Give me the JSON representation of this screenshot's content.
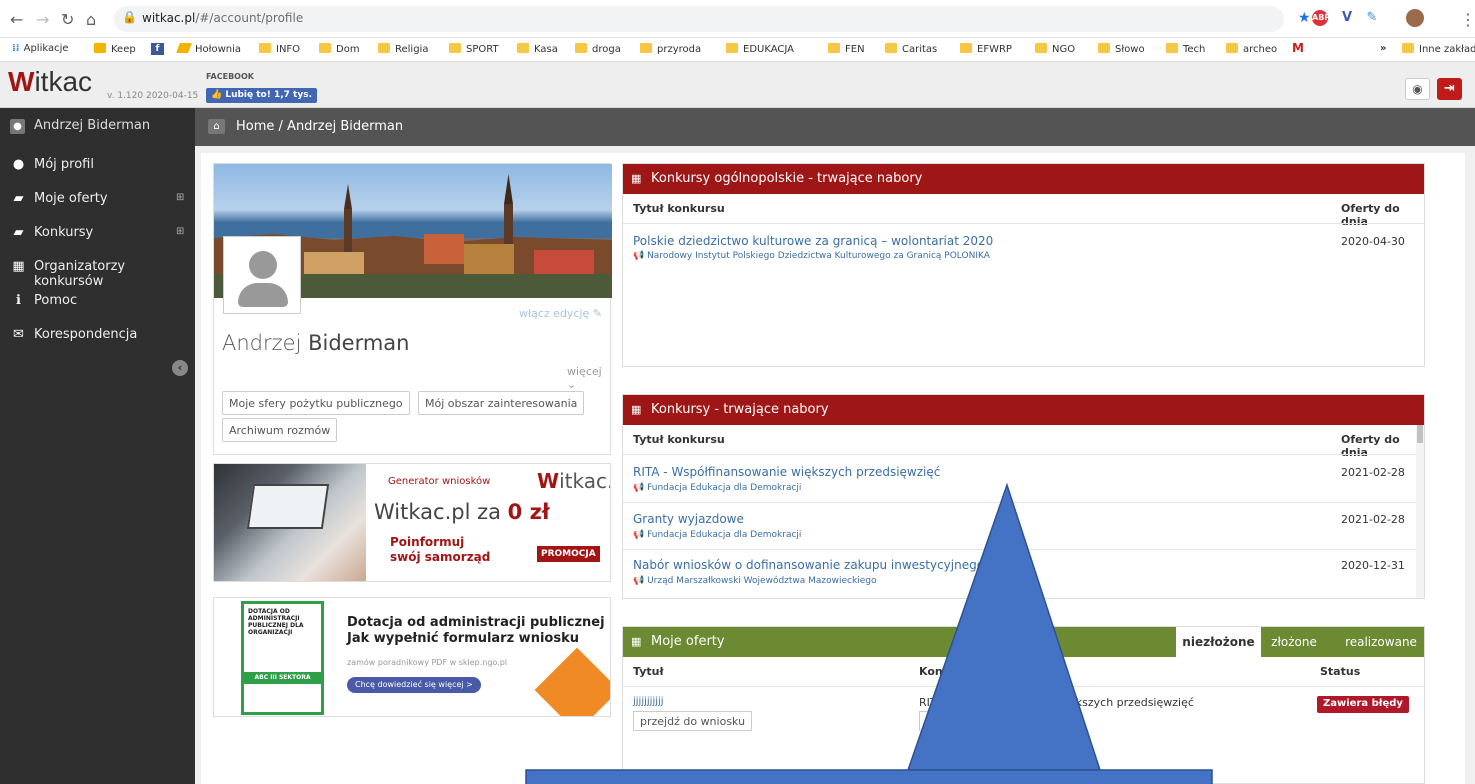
{
  "browser": {
    "url_host": "witkac.pl",
    "url_path": "/#/account/profile",
    "bookmarks": [
      "Aplikacje",
      "Keep",
      "Hołownia",
      "INFO",
      "Dom",
      "Religia",
      "SPORT",
      "Kasa",
      "droga",
      "przyroda",
      "EDUKACJA",
      "FEN",
      "Caritas",
      "EFWRP",
      "NGO",
      "Słowo",
      "Tech",
      "archeo"
    ],
    "more_bookmarks": "»",
    "other_bookmarks": "Inne zakładk"
  },
  "app": {
    "logo_letter": "W",
    "logo_rest": "itkac",
    "version": "v. 1.120 2020-04-15",
    "facebook_title": "FACEBOOK",
    "facebook_like": "Lubię to! 1,7 tys."
  },
  "user": {
    "name": "Andrzej Biderman"
  },
  "breadcrumb": {
    "home": "Home",
    "current": "Andrzej Biderman",
    "separator": " / "
  },
  "sidebar": {
    "items": [
      {
        "label": "Mój profil",
        "icon": "user-icon"
      },
      {
        "label": "Moje oferty",
        "icon": "book-icon",
        "expand": "⊞"
      },
      {
        "label": "Konkursy",
        "icon": "book-icon",
        "expand": "⊞"
      },
      {
        "label": "Organizatorzy konkursów",
        "icon": "building-icon"
      },
      {
        "label": "Pomoc",
        "icon": "info-icon"
      },
      {
        "label": "Korespondencja",
        "icon": "envelope-icon"
      }
    ]
  },
  "profile": {
    "edit_link": "włącz edycję",
    "first_name": "Andrzej ",
    "last_name": "Biderman",
    "more": "więcej ⌄",
    "buttons": [
      "Moje sfery pożytku publicznego",
      "Mój obszar zainteresowania",
      "Archiwum rozmów"
    ]
  },
  "ad1": {
    "generator": "Generator wniosków",
    "logo_letter": "W",
    "logo_rest": "itkac.pl",
    "headline": "Witkac.pl za ",
    "headline_bold": "0 zł",
    "info_line1": "Poinformuj",
    "info_line2": "swój samorząd",
    "promo": "PROMOCJA"
  },
  "ad2": {
    "book_title": "DOTACJA OD ADMINISTRACJI PUBLICZNEJ DLA ORGANIZACJI",
    "book_band": "ABC III SEKTORA",
    "title_line1": "Dotacja od administracji publicznej",
    "title_line2": "Jak wypełnić formularz wniosku",
    "subtitle": "zamów poradnikowy PDF w sklep.ngo.pl",
    "cta": "Chcę dowiedzieć się więcej >"
  },
  "panel_national": {
    "title": "Konkursy ogólnopolskie - trwające nabory",
    "col_title": "Tytuł konkursu",
    "col_date": "Oferty do dnia",
    "rows": [
      {
        "title": "Polskie dziedzictwo kulturowe za granicą – wolontariat 2020",
        "organizer": "Narodowy Instytut Polskiego Dziedzictwa Kulturowego za Granicą POLONIKA",
        "date": "2020-04-30"
      }
    ]
  },
  "panel_contests": {
    "title": "Konkursy - trwające nabory",
    "col_title": "Tytuł konkursu",
    "col_date": "Oferty do dnia",
    "rows": [
      {
        "title": "RITA - Współfinansowanie większych przedsięwzięć",
        "organizer": "Fundacja Edukacja dla Demokracji",
        "date": "2021-02-28"
      },
      {
        "title": "Granty wyjazdowe",
        "organizer": "Fundacja Edukacja dla Demokracji",
        "date": "2021-02-28"
      },
      {
        "title": "Nabór wniosków o dofinansowanie zakupu inwestycyjnego",
        "organizer": "Urząd Marszałkowski Województwa Mazowieckiego",
        "date": "2020-12-31"
      }
    ]
  },
  "panel_offers": {
    "title": "Moje oferty",
    "tabs": [
      "niezłożone",
      "złożone",
      "realizowane"
    ],
    "col_title": "Tytuł",
    "col_contest": "Konku",
    "col_status": "Status",
    "row": {
      "title": "jjjjjjjjjjj",
      "goto_button": "przejdź do wniosku",
      "contest_start": "RITA",
      "contest_end": "ększych przedsięwzięć",
      "contest_btn_start": "prz",
      "status": "Zawiera błędy"
    }
  },
  "colors": {
    "brand_red": "#a31515",
    "panel_red": "#9e1616",
    "panel_green": "#6b8a32",
    "sidebar": "#2f2f2f",
    "overlay_blue": "#4472c4",
    "overlay_border": "#2f528f"
  }
}
